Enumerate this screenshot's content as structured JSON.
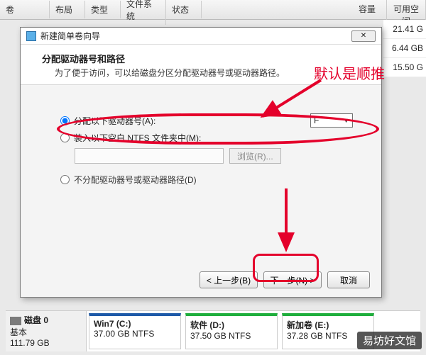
{
  "bgCols": {
    "c1": "卷",
    "c2": "布局",
    "c3": "类型",
    "c4": "文件系统",
    "c5": "状态",
    "c6": "容量",
    "c7": "可用空间"
  },
  "bgSizes": [
    "21.41 G",
    "6.44 GB",
    "15.50 G"
  ],
  "dialog": {
    "title": "新建简单卷向导",
    "close": "✕",
    "headTitle": "分配驱动器号和路径",
    "headDesc": "为了便于访问，可以给磁盘分区分配驱动器号或驱动器路径。",
    "opt1": "分配以下驱动器号(A):",
    "driveLetter": "F",
    "opt2": "装入以下空白 NTFS 文件夹中(M):",
    "browse": "浏览(R)...",
    "opt3": "不分配驱动器号或驱动器路径(D)",
    "back": "< 上一步(B)",
    "next": "下一步(N) >",
    "cancel": "取消"
  },
  "annotation": "默认是顺推",
  "disk": {
    "label": "磁盘 0",
    "type": "基本",
    "size": "111.79 GB"
  },
  "partitions": [
    {
      "name": "Win7  (C:)",
      "info": "37.00 GB NTFS",
      "cls": "blue"
    },
    {
      "name": "软件  (D:)",
      "info": "37.50 GB NTFS",
      "cls": "green"
    },
    {
      "name": "新加卷  (E:)",
      "info": "37.28 GB NTFS",
      "cls": "green"
    }
  ],
  "watermark": "易坊好文馆"
}
